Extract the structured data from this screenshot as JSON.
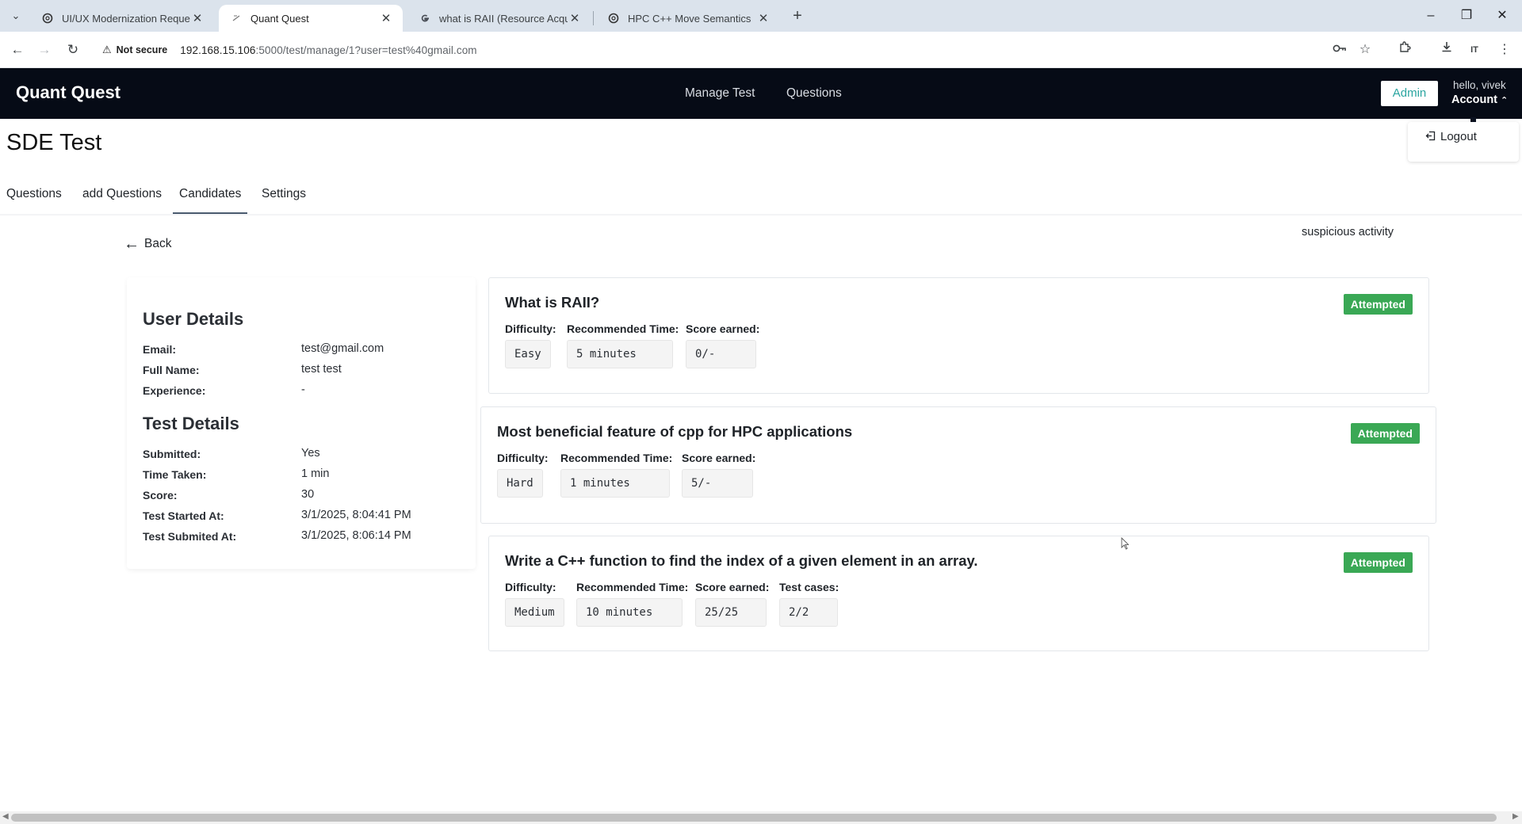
{
  "browser": {
    "tabs": [
      {
        "title": "UI/UX Modernization Request",
        "favicon": "chatgpt-icon",
        "active": false
      },
      {
        "title": "Quant Quest",
        "favicon": "page-icon",
        "active": true
      },
      {
        "title": "what is RAII (Resource Acquisiti",
        "favicon": "google-icon",
        "active": false
      },
      {
        "title": "HPC C++ Move Semantics",
        "favicon": "chatgpt-icon",
        "active": false
      }
    ],
    "security_label": "Not secure",
    "url_host": "192.168.15.106",
    "url_rest": ":5000/test/manage/1?user=test%40gmail.com"
  },
  "header": {
    "brand": "Quant Quest",
    "nav": [
      "Manage Test",
      "Questions"
    ],
    "admin_label": "Admin",
    "greeting": "hello, vivek",
    "account_label": "Account",
    "dropdown": {
      "logout_label": "Logout"
    }
  },
  "page": {
    "title": "SDE Test",
    "tabs": [
      "Questions",
      "add Questions",
      "Candidates",
      "Settings"
    ],
    "active_tab": "Candidates",
    "back_label": "Back",
    "suspicious_label": "suspicious activity"
  },
  "user_details": {
    "title": "User Details",
    "rows": [
      {
        "label": "Email:",
        "value": "test@gmail.com"
      },
      {
        "label": "Full Name:",
        "value": "test test"
      },
      {
        "label": "Experience:",
        "value": "-"
      }
    ]
  },
  "test_details": {
    "title": "Test Details",
    "rows": [
      {
        "label": "Submitted:",
        "value": "Yes"
      },
      {
        "label": "Time Taken:",
        "value": "1 min"
      },
      {
        "label": "Score:",
        "value": "30"
      },
      {
        "label": "Test Started At:",
        "value": "3/1/2025, 8:04:41 PM"
      },
      {
        "label": "Test Submited At:",
        "value": "3/1/2025, 8:06:14 PM"
      }
    ]
  },
  "questions": [
    {
      "title": "What is RAII?",
      "status": "Attempted",
      "fields": [
        {
          "label": "Difficulty:",
          "value": "Easy"
        },
        {
          "label": "Recommended Time:",
          "value": "5 minutes"
        },
        {
          "label": "Score earned:",
          "value": "0/-"
        }
      ]
    },
    {
      "title": "Most beneficial feature of cpp for HPC applications",
      "status": "Attempted",
      "fields": [
        {
          "label": "Difficulty:",
          "value": "Hard"
        },
        {
          "label": "Recommended Time:",
          "value": "1 minutes"
        },
        {
          "label": "Score earned:",
          "value": "5/-"
        }
      ]
    },
    {
      "title": "Write a C++ function to find the index of a given element in an array.",
      "status": "Attempted",
      "fields": [
        {
          "label": "Difficulty:",
          "value": "Medium"
        },
        {
          "label": "Recommended Time:",
          "value": "10 minutes"
        },
        {
          "label": "Score earned:",
          "value": "25/25"
        },
        {
          "label": "Test cases:",
          "value": "2/2"
        }
      ]
    }
  ],
  "colors": {
    "appbar": "#060b16",
    "badge": "#3aa855",
    "admin_text": "#2aa5a0"
  }
}
